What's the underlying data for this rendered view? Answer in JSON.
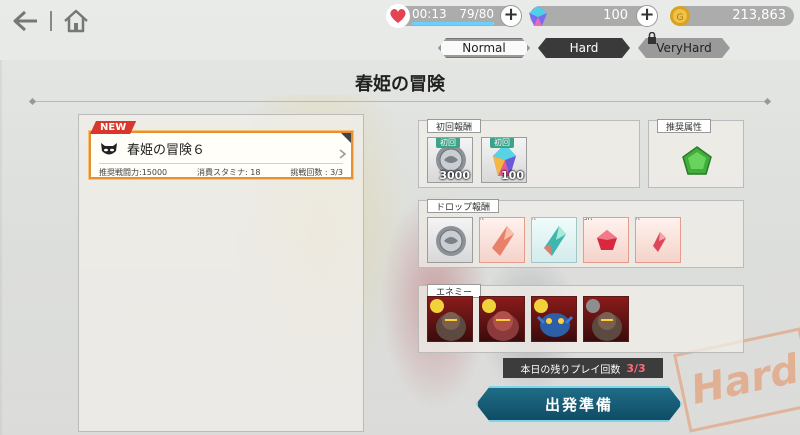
{
  "topbar": {
    "stamina_time": "00:13",
    "stamina_value": "79/80",
    "stamina_fraction": 0.9875,
    "gem_count": "100",
    "gold_count": "213,863"
  },
  "difficulty": {
    "normal": "Normal",
    "hard": "Hard",
    "veryhard": "VeryHard",
    "selected": "Hard"
  },
  "stage": {
    "title": "春姫の冒険"
  },
  "quest": {
    "badge": "NEW",
    "name": "春姫の冒険６",
    "recommended_power": "推奨戦闘力:15000",
    "stamina_cost": "消費スタミナ: 18",
    "attempts": "挑戦回数 : 3/3"
  },
  "first_reward": {
    "label": "初回報酬",
    "items": [
      {
        "tag": "初回",
        "count": "3000",
        "icon": "silver-coin-icon"
      },
      {
        "tag": "初回",
        "count": "100",
        "icon": "rainbow-crystal-icon"
      }
    ]
  },
  "recommend": {
    "label": "推奨属性",
    "icon": "green-pentagon-element-icon"
  },
  "drop_reward": {
    "label": "ドロップ報酬",
    "items": [
      {
        "rarity": "",
        "icon": "silver-coin-icon"
      },
      {
        "rarity": "R",
        "icon": "orange-crystal-icon"
      },
      {
        "rarity": "R",
        "icon": "teal-crystal-icon"
      },
      {
        "rarity": "SR",
        "icon": "red-gem-icon"
      },
      {
        "rarity": "R",
        "icon": "small-red-crystal-icon"
      }
    ]
  },
  "enemy": {
    "label": "エネミー",
    "cards": [
      {
        "element_color": "#f0d23a"
      },
      {
        "element_color": "#f0d23a"
      },
      {
        "element_color": "#f0d23a"
      },
      {
        "element_color": "#8e8e8e"
      }
    ]
  },
  "remaining": {
    "label": "本日の残りプレイ回数",
    "count": "3/3"
  },
  "depart_button": "出発準備",
  "stamp_text": "Hard",
  "colors": {
    "accent_orange": "#e8902f",
    "new_red": "#d9372c",
    "depart_teal": "#1f6f8a",
    "hard_tab": "#3a3a3a"
  }
}
